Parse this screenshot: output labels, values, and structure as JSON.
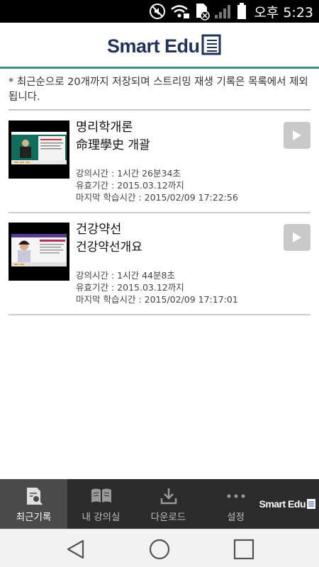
{
  "status_bar": {
    "time": "오후 5:23",
    "icons": [
      "mute-icon",
      "wifi-lock-icon",
      "sim-off-icon",
      "signal-icon",
      "battery-icon"
    ]
  },
  "header": {
    "logo_text": "Smart Edu"
  },
  "notice": "* 최근순으로 20개까지 저장되며 스트리밍 재생 기록은 목록에서 제외 됩니다.",
  "records": [
    {
      "title": "명리학개론",
      "subtitle": "命理學史 개괄",
      "duration": "강의시간 : 1시간 26분34초",
      "valid_until": "유효기간 : 2015.03.12까지",
      "last_study": "마지막 학습시간 : 2015/02/09 17:22:56"
    },
    {
      "title": "건강약선",
      "subtitle": "건강약선개요",
      "duration": "강의시간 : 1시간 44분8초",
      "valid_until": "유효기간 : 2015.03.12까지",
      "last_study": "마지막 학습시간 : 2015/02/09 17:17:01"
    }
  ],
  "tabs": [
    {
      "label": "최근기록",
      "icon": "recent-record-icon",
      "active": true
    },
    {
      "label": "내 강의실",
      "icon": "my-classroom-icon",
      "active": false
    },
    {
      "label": "다운로드",
      "icon": "download-icon",
      "active": false
    },
    {
      "label": "설정",
      "icon": "more-icon",
      "active": false
    }
  ],
  "tab_brand": "Smart Edu",
  "colors": {
    "brand_navy": "#1f3258",
    "accent_teal": "#3d8d8f",
    "tab_bar": "#2b2b2b",
    "tab_active": "#4a4a4a",
    "play_button": "#c9c9c9"
  }
}
